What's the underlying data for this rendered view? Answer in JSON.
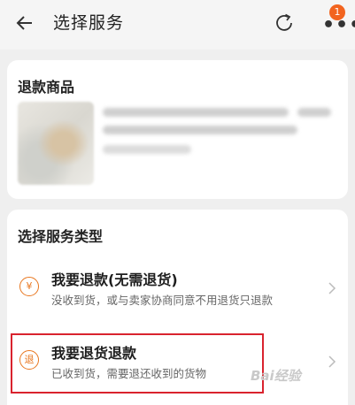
{
  "header": {
    "title": "选择服务",
    "badge_count": "1",
    "icons": [
      "back-arrow",
      "refresh",
      "more"
    ]
  },
  "goods": {
    "section_title": "退款商品"
  },
  "service": {
    "section_title": "选择服务类型",
    "options": [
      {
        "icon_text": "¥",
        "title": "我要退款(无需退货)",
        "desc": "没收到货，或与卖家协商同意不用退货只退款"
      },
      {
        "icon_text": "退",
        "title": "我要退货退款",
        "desc": "已收到货，需要退还收到的货物"
      }
    ]
  },
  "watermark": "Bai经验",
  "colors": {
    "accent": "#e8761e",
    "badge": "#f2641f",
    "highlight": "#d9232e"
  }
}
